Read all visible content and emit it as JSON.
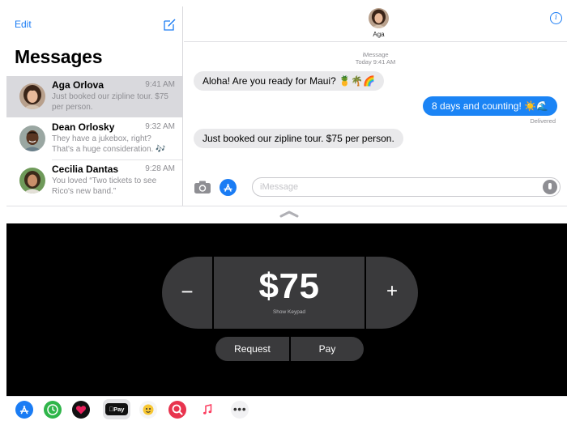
{
  "sidebar": {
    "edit_label": "Edit",
    "title": "Messages",
    "conversations": [
      {
        "name": "Aga Orlova",
        "time": "9:41 AM",
        "preview": "Just booked our zipline tour. $75 per person.",
        "selected": true
      },
      {
        "name": "Dean Orlosky",
        "time": "9:32 AM",
        "preview": "They have a jukebox, right? That's a huge consideration. 🎶",
        "selected": false
      },
      {
        "name": "Cecilia Dantas",
        "time": "9:28 AM",
        "preview": "You loved “Two tickets to see Rico's new band.”",
        "selected": false
      }
    ]
  },
  "conversation": {
    "contact_name": "Aga",
    "service_label": "iMessage",
    "timestamp": "Today 9:41 AM",
    "messages": [
      {
        "direction": "in",
        "text": "Aloha! Are you ready for Maui? 🍍🌴🌈"
      },
      {
        "direction": "out",
        "text": "8 days and counting! ☀️🌊"
      },
      {
        "direction": "in",
        "text": "Just booked our zipline tour. $75 per person."
      }
    ],
    "delivered_label": "Delivered",
    "input_placeholder": "iMessage"
  },
  "apple_pay": {
    "amount": "$75",
    "keypad_hint": "Show Keypad",
    "minus_label": "−",
    "plus_label": "+",
    "request_label": "Request",
    "pay_label": "Pay"
  },
  "app_drawer": {
    "apps": [
      {
        "name": "app-store-icon",
        "color": "#1a7cf4"
      },
      {
        "name": "recents-icon",
        "color": "#2fb54a"
      },
      {
        "name": "digital-touch-icon",
        "color": "#e8205c"
      },
      {
        "name": "apple-pay-icon",
        "label": "Pay",
        "selected": true
      },
      {
        "name": "animoji-icon",
        "color": "#f7c631"
      },
      {
        "name": "image-search-icon",
        "color": "#e8344e"
      },
      {
        "name": "music-icon",
        "color": "#fc3c5f"
      },
      {
        "name": "more-icon"
      }
    ]
  },
  "colors": {
    "accent_blue": "#1a7cf4",
    "outgoing_bubble": "#1b84f5",
    "incoming_bubble": "#e9e9eb",
    "pay_panel": "#000000",
    "pay_button": "#3a3a3c"
  }
}
